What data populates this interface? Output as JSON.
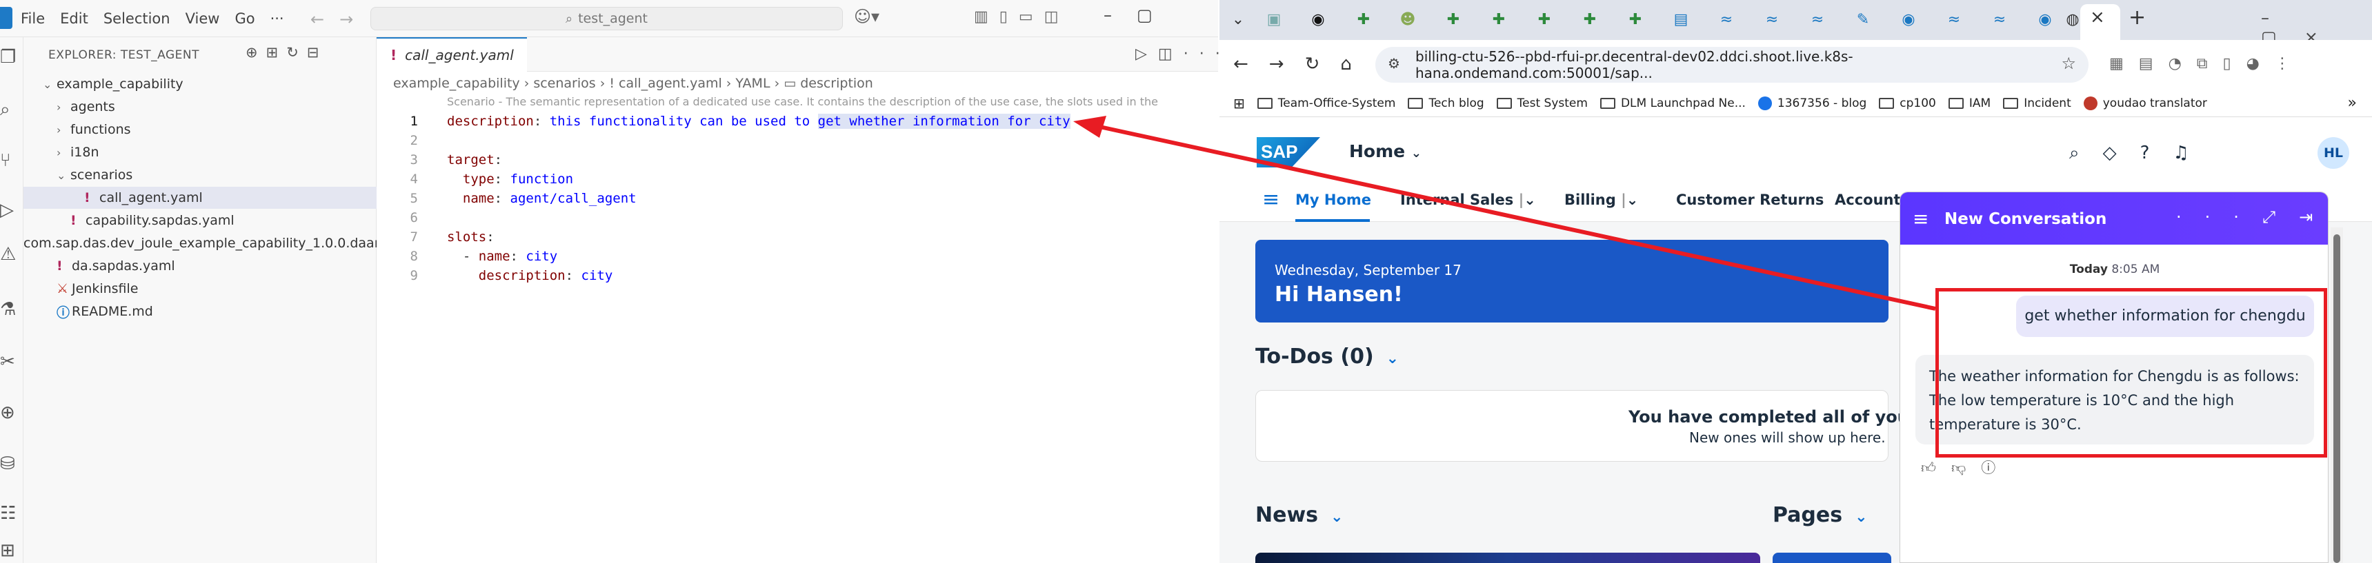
{
  "vscode": {
    "menu": [
      "File",
      "Edit",
      "Selection",
      "View",
      "Go"
    ],
    "more_menu": "···",
    "search": "test_agent",
    "explorer_title": "EXPLORER: TEST_AGENT",
    "tree": [
      {
        "label": "example_capability",
        "chev": "⌄",
        "indent": 0,
        "icon": ""
      },
      {
        "label": "agents",
        "chev": "›",
        "indent": 1,
        "icon": ""
      },
      {
        "label": "functions",
        "chev": "›",
        "indent": 1,
        "icon": ""
      },
      {
        "label": "i18n",
        "chev": "›",
        "indent": 1,
        "icon": ""
      },
      {
        "label": "scenarios",
        "chev": "⌄",
        "indent": 1,
        "icon": ""
      },
      {
        "label": "call_agent.yaml",
        "chev": "",
        "indent": 2,
        "icon": "!"
      },
      {
        "label": "capability.sapdas.yaml",
        "chev": "",
        "indent": 1,
        "icon": "!"
      },
      {
        "label": "com.sap.das.dev_joule_example_capability_1.0.0.daar",
        "chev": "",
        "indent": 0,
        "icon": ""
      },
      {
        "label": "da.sapdas.yaml",
        "chev": "",
        "indent": 0,
        "icon": "!"
      },
      {
        "label": "Jenkinsfile",
        "chev": "",
        "indent": 0,
        "icon": "⚔"
      },
      {
        "label": "README.md",
        "chev": "",
        "indent": 0,
        "icon": "ⓘ"
      }
    ],
    "tab_label": "call_agent.yaml",
    "breadcrumb": "example_capability  ›  scenarios  ›  !  call_agent.yaml  ›  YAML  ›  ▭ description",
    "codelens": "Scenario - The semantic representation of a dedicated use case. It contains the description of the use case, the slots used in the",
    "code": {
      "l1_key": "description",
      "l1_val_a": "this functionality can be used to ",
      "l1_val_b": "get whether information for city",
      "l3_key": "target",
      "l4_key": "type",
      "l4_val": "function",
      "l5_key": "name",
      "l5_val": "agent/call_agent",
      "l7_key": "slots",
      "l8_key": "name",
      "l8_val": "city",
      "l9_key": "description",
      "l9_val": "city"
    },
    "line_numbers": [
      "1",
      "2",
      "3",
      "4",
      "5",
      "6",
      "7",
      "8",
      "9"
    ]
  },
  "browser": {
    "url": "billing-ctu-526--pbd-rfui-pr.decentral-dev02.ddci.shoot.live.k8s-hana.ondemand.com:50001/sap...",
    "bookmarks": [
      {
        "label": "Team-Office-System",
        "kind": "folder"
      },
      {
        "label": "Tech blog",
        "kind": "folder"
      },
      {
        "label": "Test System",
        "kind": "folder"
      },
      {
        "label": "DLM Launchpad Ne...",
        "kind": "folder"
      },
      {
        "label": "1367356 - blog",
        "kind": "site"
      },
      {
        "label": "cp100",
        "kind": "folder"
      },
      {
        "label": "IAM",
        "kind": "folder"
      },
      {
        "label": "Incident",
        "kind": "folder"
      },
      {
        "label": "youdao translator",
        "kind": "site"
      }
    ],
    "bookmarks_more": "»"
  },
  "sap": {
    "logo": "SAP",
    "home": "Home",
    "avatar": "HL",
    "nav": {
      "my_home": "My Home",
      "internal_sales": "Internal Sales",
      "billing": "Billing",
      "customer_returns": "Customer Returns",
      "accounts": "Accounts"
    },
    "welcome_date": "Wednesday, September 17",
    "welcome_greet": "Hi Hansen!",
    "todos_title": "To-Dos (0)",
    "todos_msg": "You have completed all of your to-d",
    "todos_sub": "New ones will show up here.",
    "news_title": "News",
    "pages_title": "Pages"
  },
  "chat": {
    "title": "New Conversation",
    "time_day": "Today",
    "time_clock": "8:05 AM",
    "user_msg": "get whether information for chengdu",
    "bot_msg": "The weather information for Chengdu is as follows: The low temperature is 10°C and the high temperature is 30°C."
  },
  "colors": {
    "annotation": "#e81c23",
    "joule_header": "#5b36ff",
    "sap_blue": "#0a6ed1",
    "welcome_card": "#1a58c6"
  }
}
